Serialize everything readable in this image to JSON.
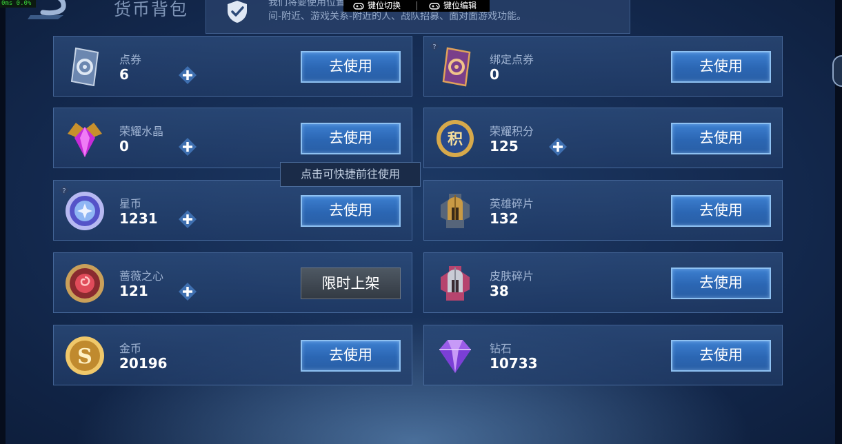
{
  "overlay": {
    "fps_text": "0ms  0.0%",
    "key_switch": "键位切换",
    "key_edit": "键位编辑"
  },
  "header": {
    "title": "货币背包"
  },
  "notice": {
    "line1": "我们将要使用位置信息…………荣耀战区、组队房",
    "line2": "间-附近、游戏关系-附近的人、战队招募、面对面游戏功能。"
  },
  "tooltip": "点击可快捷前往使用",
  "currencies": [
    {
      "name": "点券",
      "amount": "6",
      "button": "去使用",
      "icon": "coupon-card-icon",
      "has_plus": true
    },
    {
      "name": "绑定点券",
      "amount": "0",
      "button": "去使用",
      "icon": "bound-coupon-card-icon",
      "has_plus": false
    },
    {
      "name": "荣耀水晶",
      "amount": "0",
      "button": "去使用",
      "icon": "glory-crystal-icon",
      "has_plus": true
    },
    {
      "name": "荣耀积分",
      "amount": "125",
      "button": "去使用",
      "icon": "glory-points-medal-icon",
      "has_plus": true
    },
    {
      "name": "星币",
      "amount": "1231",
      "button": "去使用",
      "icon": "star-coin-icon",
      "has_plus": true
    },
    {
      "name": "英雄碎片",
      "amount": "132",
      "button": "去使用",
      "icon": "hero-shard-helmet-icon",
      "has_plus": false
    },
    {
      "name": "蔷薇之心",
      "amount": "121",
      "button": "限时上架",
      "icon": "rose-heart-icon",
      "has_plus": true
    },
    {
      "name": "皮肤碎片",
      "amount": "38",
      "button": "去使用",
      "icon": "skin-shard-helmet-icon",
      "has_plus": false
    },
    {
      "name": "金币",
      "amount": "20196",
      "button": "去使用",
      "icon": "gold-coin-icon",
      "has_plus": false
    },
    {
      "name": "钻石",
      "amount": "10733",
      "button": "去使用",
      "icon": "diamond-icon",
      "has_plus": false
    }
  ],
  "colors": {
    "button_blue": "#2b66b3",
    "button_border": "#8ec1f2",
    "limited_gray": "#333a43",
    "panel_blue": "#2e4e7e"
  }
}
